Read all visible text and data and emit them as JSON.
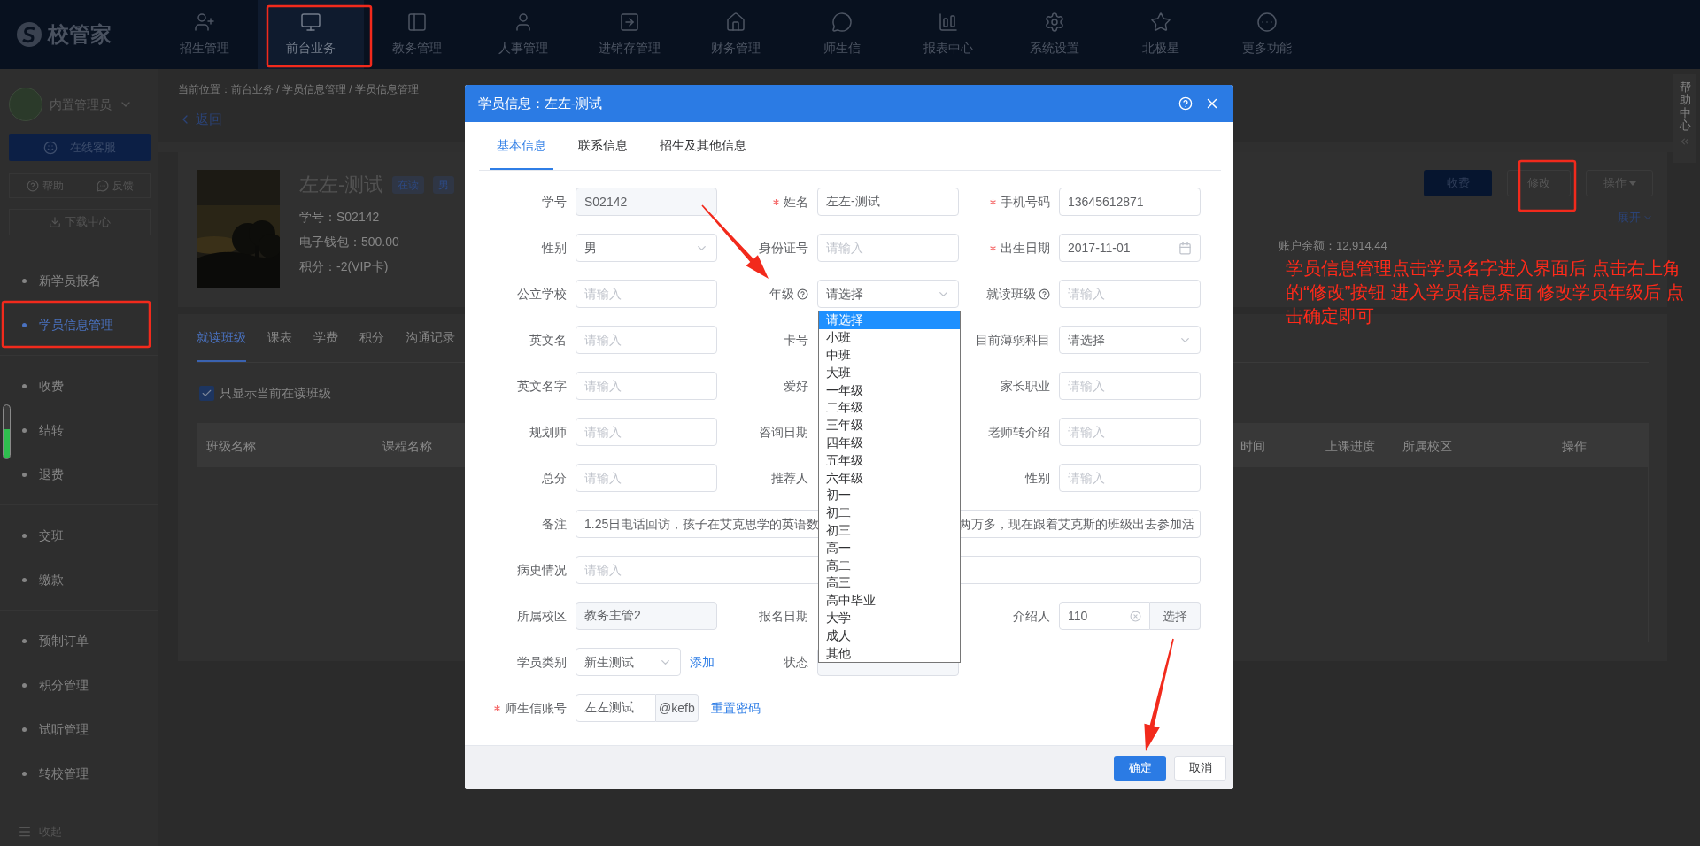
{
  "top_nav": {
    "logo": "校管家",
    "items": [
      {
        "label": "招生管理",
        "selected": false
      },
      {
        "label": "前台业务",
        "selected": true
      },
      {
        "label": "教务管理",
        "selected": false
      },
      {
        "label": "人事管理",
        "selected": false
      },
      {
        "label": "进销存管理",
        "selected": false
      },
      {
        "label": "财务管理",
        "selected": false
      },
      {
        "label": "师生信",
        "selected": false
      },
      {
        "label": "报表中心",
        "selected": false
      },
      {
        "label": "系统设置",
        "selected": false
      },
      {
        "label": "北极星",
        "selected": false
      },
      {
        "label": "更多功能",
        "selected": false
      }
    ]
  },
  "sidebar": {
    "user": "内置管理员",
    "service_button": "在线客服",
    "help": "帮助",
    "feedback": "反馈",
    "download": "下载中心",
    "groups": [
      {
        "items": [
          {
            "label": "新学员报名",
            "selected": false
          },
          {
            "label": "学员信息管理",
            "selected": true
          }
        ]
      },
      {
        "items": [
          {
            "label": "收费",
            "selected": false
          },
          {
            "label": "结转",
            "selected": false
          },
          {
            "label": "退费",
            "selected": false
          }
        ]
      },
      {
        "items": [
          {
            "label": "交班",
            "selected": false
          },
          {
            "label": "缴款",
            "selected": false
          }
        ]
      },
      {
        "items": [
          {
            "label": "预制订单",
            "selected": false
          },
          {
            "label": "积分管理",
            "selected": false
          },
          {
            "label": "试听管理",
            "selected": false
          },
          {
            "label": "转校管理",
            "selected": false
          }
        ]
      }
    ],
    "collapse": "收起"
  },
  "page": {
    "breadcrumb": "当前位置：前台业务 / 学员信息管理 / 学员信息管理",
    "back": "返回",
    "student": {
      "name": "左左-测试",
      "tags": [
        "在读",
        "男"
      ],
      "id_line": "学号：S02142",
      "wallet": "电子钱包：500.00",
      "points": "积分：-2(VIP卡)"
    },
    "actions": [
      {
        "label": "收费",
        "kind": "primary"
      },
      {
        "label": "修改",
        "kind": "default"
      },
      {
        "label": "操作",
        "kind": "menu"
      }
    ],
    "expand": "展开",
    "balance": "账户余额：12,914.44",
    "tabs": [
      {
        "label": "就读班级",
        "selected": true
      },
      {
        "label": "课表",
        "selected": false
      },
      {
        "label": "学费",
        "selected": false
      },
      {
        "label": "积分",
        "selected": false
      },
      {
        "label": "沟通记录",
        "selected": false
      }
    ],
    "only_current": {
      "label": "只显示当前在读班级",
      "checked": true
    },
    "table": {
      "columns": [
        "班级名称",
        "课程名称",
        "时间",
        "上课进度",
        "所属校区",
        "操作"
      ]
    }
  },
  "help_center": {
    "label": "帮助中心"
  },
  "dialog": {
    "title": "学员信息：左左-测试",
    "tabs": [
      {
        "label": "基本信息",
        "selected": true
      },
      {
        "label": "联系信息",
        "selected": false
      },
      {
        "label": "招生及其他信息",
        "selected": false
      }
    ],
    "rows": [
      [
        {
          "label": "学号",
          "required": false,
          "help": false,
          "kind": "readonly",
          "value": "S02142"
        },
        {
          "label": "姓名",
          "required": true,
          "help": false,
          "kind": "input",
          "value": "左左-测试"
        },
        {
          "label": "手机号码",
          "required": true,
          "help": false,
          "kind": "input",
          "value": "13645612871"
        }
      ],
      [
        {
          "label": "性别",
          "required": false,
          "help": false,
          "kind": "select",
          "value": "男"
        },
        {
          "label": "身份证号",
          "required": false,
          "help": false,
          "kind": "input",
          "placeholder": "请输入"
        },
        {
          "label": "出生日期",
          "required": true,
          "help": false,
          "kind": "date",
          "value": "2017-11-01"
        }
      ],
      [
        {
          "label": "公立学校",
          "required": false,
          "help": false,
          "kind": "input",
          "placeholder": "请输入"
        },
        {
          "label": "年级",
          "required": false,
          "help": true,
          "kind": "select",
          "value": "请选择"
        },
        {
          "label": "就读班级",
          "required": false,
          "help": true,
          "kind": "input",
          "placeholder": "请输入"
        }
      ],
      [
        {
          "label": "英文名",
          "required": false,
          "help": false,
          "kind": "input",
          "placeholder": "请输入"
        },
        {
          "label": "卡号",
          "required": false,
          "help": false,
          "kind": "covered"
        },
        {
          "label": "目前薄弱科目",
          "required": false,
          "help": false,
          "kind": "select",
          "value": "请选择"
        }
      ],
      [
        {
          "label": "英文名字",
          "required": false,
          "help": false,
          "kind": "input",
          "placeholder": "请输入"
        },
        {
          "label": "爱好",
          "required": false,
          "help": false,
          "kind": "covered"
        },
        {
          "label": "家长职业",
          "required": false,
          "help": false,
          "kind": "input",
          "placeholder": "请输入"
        }
      ],
      [
        {
          "label": "规划师",
          "required": false,
          "help": false,
          "kind": "input",
          "placeholder": "请输入"
        },
        {
          "label": "咨询日期",
          "required": false,
          "help": false,
          "kind": "covered"
        },
        {
          "label": "老师转介绍",
          "required": false,
          "help": false,
          "kind": "input",
          "placeholder": "请输入"
        }
      ],
      [
        {
          "label": "总分",
          "required": false,
          "help": false,
          "kind": "input",
          "placeholder": "请输入"
        },
        {
          "label": "推荐人",
          "required": false,
          "help": false,
          "kind": "covered"
        },
        {
          "label": "性别",
          "required": false,
          "help": false,
          "kind": "input",
          "placeholder": "请输入"
        }
      ],
      [
        {
          "label": "备注",
          "required": false,
          "help": false,
          "kind": "wide",
          "value_start": "1.25日电话回访，孩子在艾克思学的英语数",
          "value_end": "两万多，现在跟着艾克斯的班级出去参加活"
        }
      ],
      [
        {
          "label": "病史情况",
          "required": false,
          "help": false,
          "kind": "wide",
          "placeholder": "请输入"
        }
      ],
      [
        {
          "label": "所属校区",
          "required": false,
          "help": false,
          "kind": "readonly",
          "value": "教务主管2"
        },
        {
          "label": "报名日期",
          "required": false,
          "help": false,
          "kind": "covered"
        },
        {
          "label": "介绍人",
          "required": false,
          "help": false,
          "kind": "picker",
          "value": "110",
          "button": "选择"
        }
      ],
      [
        {
          "label": "学员类别",
          "required": false,
          "help": false,
          "kind": "select_link",
          "value": "新生测试",
          "link": "添加"
        },
        {
          "label": "状态",
          "required": false,
          "help": false,
          "kind": "readonly"
        }
      ],
      [
        {
          "label": "师生信账号",
          "required": true,
          "help": false,
          "kind": "account",
          "value": "左左测试",
          "suffix": "@kefb",
          "link": "重置密码"
        }
      ]
    ],
    "dropdown": {
      "options": [
        {
          "label": "请选择",
          "selected": true
        },
        {
          "label": "小班",
          "selected": false
        },
        {
          "label": "中班",
          "selected": false
        },
        {
          "label": "大班",
          "selected": false
        },
        {
          "label": "一年级",
          "selected": false
        },
        {
          "label": "二年级",
          "selected": false
        },
        {
          "label": "三年级",
          "selected": false
        },
        {
          "label": "四年级",
          "selected": false
        },
        {
          "label": "五年级",
          "selected": false
        },
        {
          "label": "六年级",
          "selected": false
        },
        {
          "label": "初一",
          "selected": false
        },
        {
          "label": "初二",
          "selected": false
        },
        {
          "label": "初三",
          "selected": false
        },
        {
          "label": "高一",
          "selected": false
        },
        {
          "label": "高二",
          "selected": false
        },
        {
          "label": "高三",
          "selected": false
        },
        {
          "label": "高中毕业",
          "selected": false
        },
        {
          "label": "大学",
          "selected": false
        },
        {
          "label": "成人",
          "selected": false
        },
        {
          "label": "其他",
          "selected": false
        }
      ]
    },
    "buttons": [
      {
        "label": "确定",
        "kind": "primary"
      },
      {
        "label": "取消",
        "kind": "default"
      }
    ]
  },
  "annotation": {
    "text": "学员信息管理点击学员名字进入界面后 点击右上角的“修改”按钮  进入学员信息界面 修改学员年级后 点击确定即可"
  }
}
